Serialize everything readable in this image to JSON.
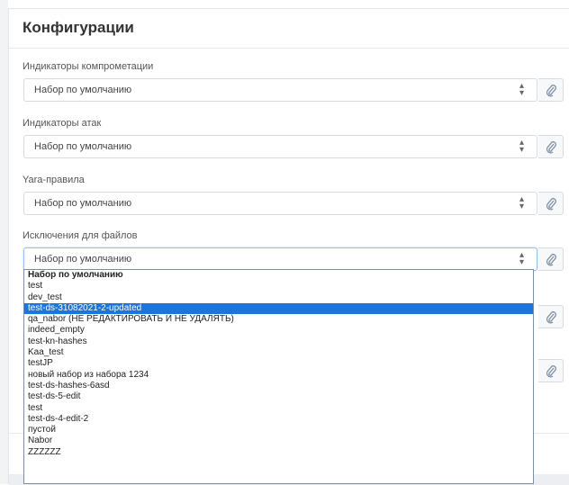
{
  "title": "Конфигурации",
  "fields": [
    {
      "label": "Индикаторы компрометации",
      "value": "Набор по умолчанию"
    },
    {
      "label": "Индикаторы атак",
      "value": "Набор по умолчанию"
    },
    {
      "label": "Yara-правила",
      "value": "Набор по умолчанию"
    },
    {
      "label": "Исключения для файлов",
      "value": "Набор по умолчанию"
    }
  ],
  "icons": {
    "arrows": "sort-arrows-icon",
    "attach": "paperclip-icon"
  },
  "dropdown": {
    "selected_index": 3,
    "options": [
      "Набор по умолчанию",
      "test",
      "dev_test",
      "test-ds-31082021-2-updated",
      "qa_nabor (НЕ РЕДАКТИРОВАТЬ И НЕ УДАЛЯТЬ)",
      "indeed_empty",
      "test-kn-hashes",
      "Kaa_test",
      "testJP",
      "новый набор из набора 1234",
      "test-ds-hashes-6asd",
      "test-ds-5-edit",
      "test",
      "test-ds-4-edit-2",
      "пустой",
      "Nabor",
      "ZZZZZZ"
    ]
  },
  "colors": {
    "accent": "#1e74d9",
    "focus_border": "#9ac0ea",
    "icon": "#7d8fa3"
  }
}
